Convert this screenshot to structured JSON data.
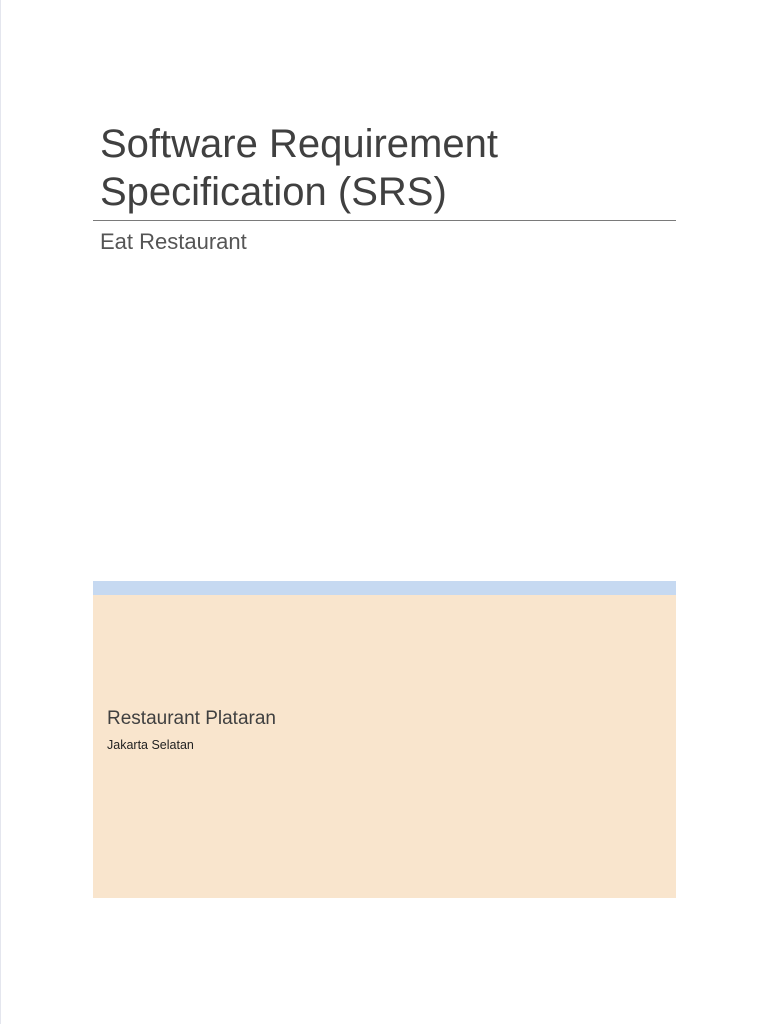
{
  "document": {
    "title": "Software Requirement Specification (SRS)",
    "subtitle": "Eat Restaurant",
    "organization": "Restaurant Plataran",
    "location": "Jakarta Selatan"
  },
  "colors": {
    "accent_bar": "#c6d9f1",
    "panel": "#f9e5cd"
  }
}
